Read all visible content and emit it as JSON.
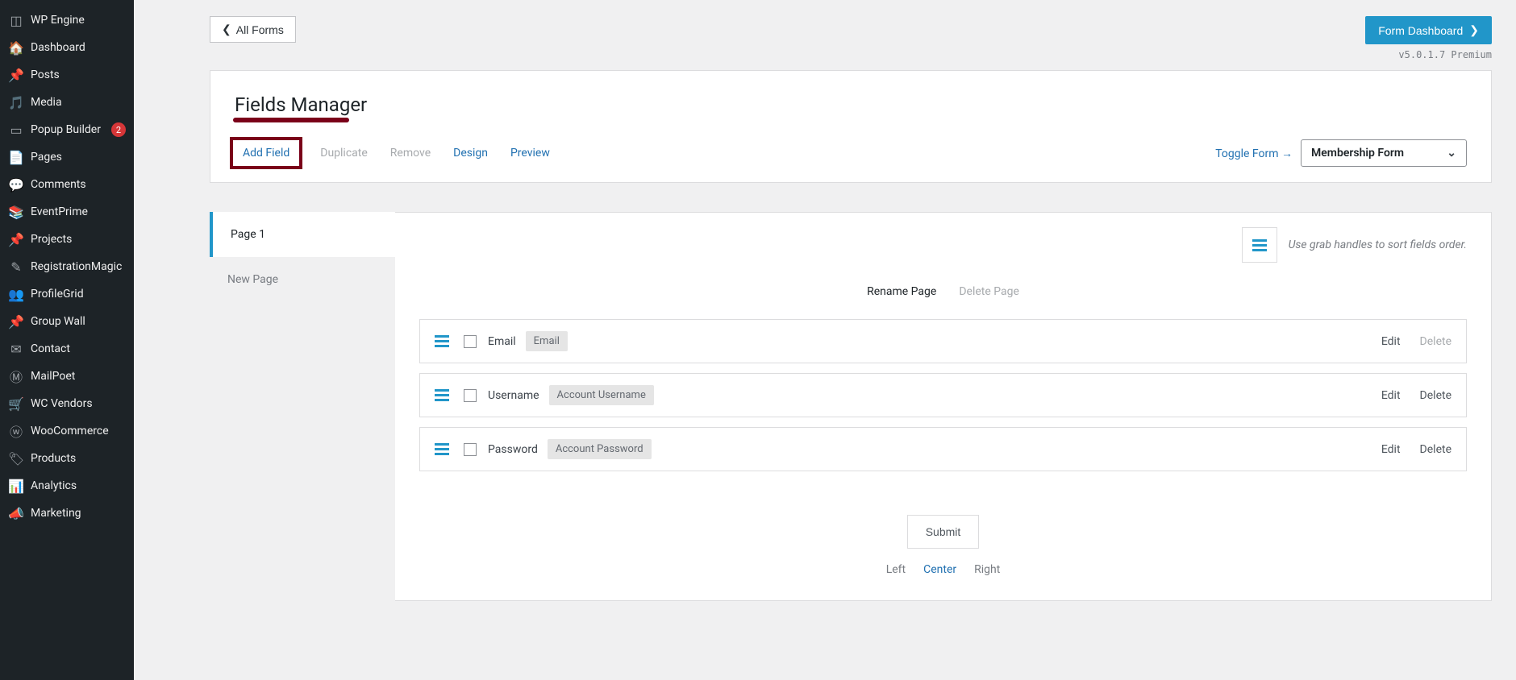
{
  "sidebar": {
    "items": [
      {
        "label": "WP Engine",
        "icon": "wpengine"
      },
      {
        "label": "Dashboard",
        "icon": "dashboard"
      },
      {
        "label": "Posts",
        "icon": "pin"
      },
      {
        "label": "Media",
        "icon": "media"
      },
      {
        "label": "Popup Builder",
        "icon": "popup",
        "badge": "2"
      },
      {
        "label": "Pages",
        "icon": "pages"
      },
      {
        "label": "Comments",
        "icon": "comments"
      },
      {
        "label": "EventPrime",
        "icon": "event"
      },
      {
        "label": "Projects",
        "icon": "pin"
      },
      {
        "label": "RegistrationMagic",
        "icon": "reg"
      },
      {
        "label": "ProfileGrid",
        "icon": "users"
      },
      {
        "label": "Group Wall",
        "icon": "pin"
      },
      {
        "label": "Contact",
        "icon": "mail"
      },
      {
        "label": "MailPoet",
        "icon": "mailpoet"
      },
      {
        "label": "WC Vendors",
        "icon": "cart"
      },
      {
        "label": "WooCommerce",
        "icon": "woo"
      },
      {
        "label": "Products",
        "icon": "products"
      },
      {
        "label": "Analytics",
        "icon": "analytics"
      },
      {
        "label": "Marketing",
        "icon": "marketing"
      }
    ]
  },
  "top": {
    "back": "All Forms",
    "dashboard": "Form Dashboard",
    "version": "v5.0.1.7 Premium"
  },
  "panel": {
    "title": "Fields Manager",
    "toolbar": {
      "add_field": "Add Field",
      "duplicate": "Duplicate",
      "remove": "Remove",
      "design": "Design",
      "preview": "Preview"
    },
    "toggle_label": "Toggle Form →",
    "form_select": "Membership Form"
  },
  "pages": {
    "active": "Page 1",
    "new": "New Page"
  },
  "fields_head": {
    "sort_hint": "Use grab handles to sort fields order."
  },
  "page_actions": {
    "rename": "Rename Page",
    "delete": "Delete Page"
  },
  "fields": [
    {
      "name": "Email",
      "type": "Email",
      "edit": "Edit",
      "delete": "Delete",
      "delete_muted": true
    },
    {
      "name": "Username",
      "type": "Account Username",
      "edit": "Edit",
      "delete": "Delete",
      "delete_muted": false
    },
    {
      "name": "Password",
      "type": "Account Password",
      "edit": "Edit",
      "delete": "Delete",
      "delete_muted": false
    }
  ],
  "submit": {
    "label": "Submit",
    "align": {
      "left": "Left",
      "center": "Center",
      "right": "Right"
    }
  }
}
